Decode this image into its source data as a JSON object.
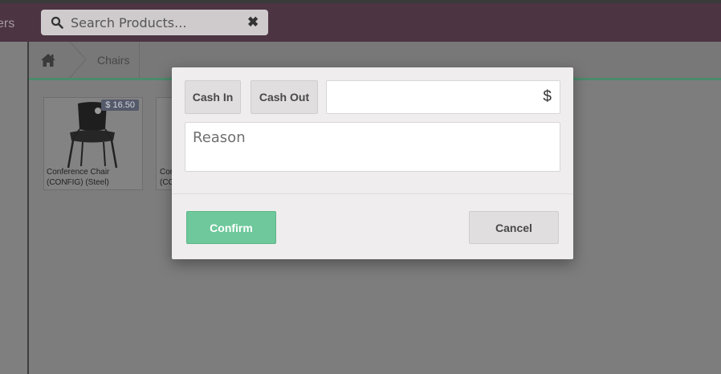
{
  "header": {
    "nav_partial_label": "ers",
    "search": {
      "placeholder": "Search Products...",
      "value": ""
    },
    "clear_icon": "close-icon"
  },
  "breadcrumb": {
    "home_icon": "home-icon",
    "items": [
      {
        "label": "Chairs"
      }
    ]
  },
  "products": [
    {
      "name": "Conference Chair (CONFIG) (Steel)",
      "price": "$ 16.50"
    },
    {
      "name": "Cor (CC"
    }
  ],
  "modal": {
    "cash_in_label": "Cash In",
    "cash_out_label": "Cash Out",
    "amount": {
      "value": "",
      "currency_symbol": "$"
    },
    "reason": {
      "placeholder": "Reason",
      "value": ""
    },
    "confirm_label": "Confirm",
    "cancel_label": "Cancel"
  },
  "colors": {
    "topbar": "#4c3443",
    "accent_green": "#6ec89b",
    "divider_green": "#4c8a6a"
  }
}
